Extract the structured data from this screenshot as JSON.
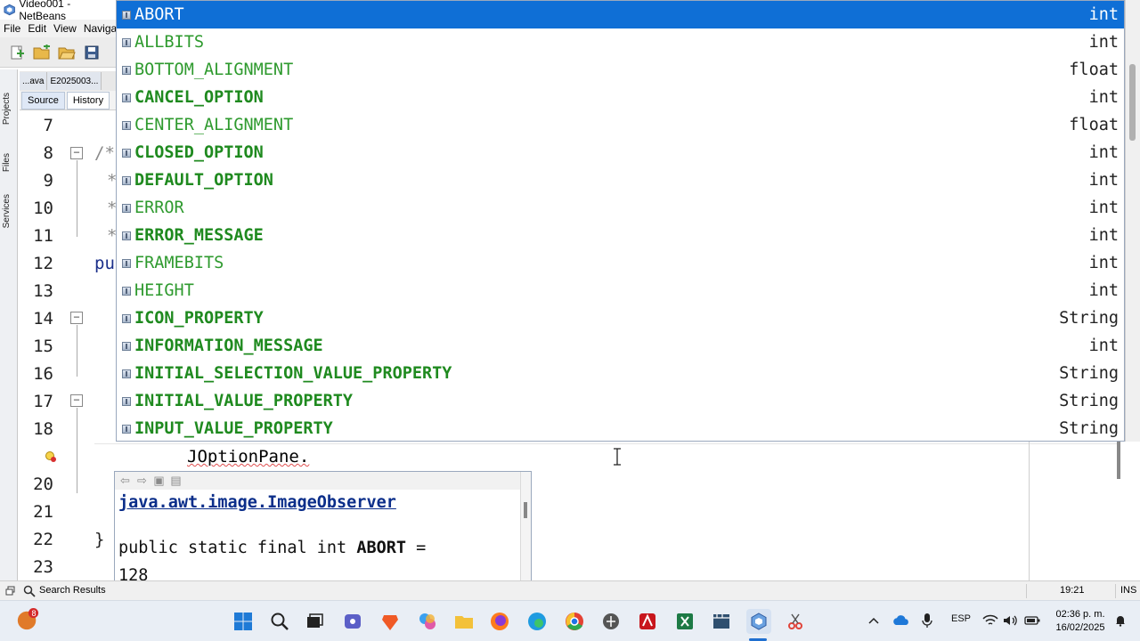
{
  "window": {
    "title": "Video001 - NetBeans"
  },
  "menu": [
    "File",
    "Edit",
    "View",
    "Navigate"
  ],
  "side_panels": [
    "Projects",
    "Files",
    "Services"
  ],
  "editor_tabs": [
    "...ava",
    "E2025003..."
  ],
  "editor_modes": {
    "source": "Source",
    "history": "History"
  },
  "code": {
    "line_numbers": [
      "7",
      "8",
      "9",
      "10",
      "11",
      "12",
      "13",
      "14",
      "15",
      "16",
      "17",
      "18",
      "20",
      "21",
      "22",
      "23"
    ],
    "fragments": {
      "comment_open": "/*",
      "star_9": "*",
      "star_10": "*",
      "star_11": "*",
      "pu": "pu",
      "close_brace": "}"
    },
    "typed": "JOptionPane",
    "typed_dot": "."
  },
  "completion": {
    "items": [
      {
        "name": "ABORT",
        "type": "int",
        "bold": false,
        "selected": true
      },
      {
        "name": "ALLBITS",
        "type": "int",
        "bold": false,
        "selected": false
      },
      {
        "name": "BOTTOM_ALIGNMENT",
        "type": "float",
        "bold": false,
        "selected": false
      },
      {
        "name": "CANCEL_OPTION",
        "type": "int",
        "bold": true,
        "selected": false
      },
      {
        "name": "CENTER_ALIGNMENT",
        "type": "float",
        "bold": false,
        "selected": false
      },
      {
        "name": "CLOSED_OPTION",
        "type": "int",
        "bold": true,
        "selected": false
      },
      {
        "name": "DEFAULT_OPTION",
        "type": "int",
        "bold": true,
        "selected": false
      },
      {
        "name": "ERROR",
        "type": "int",
        "bold": false,
        "selected": false
      },
      {
        "name": "ERROR_MESSAGE",
        "type": "int",
        "bold": true,
        "selected": false
      },
      {
        "name": "FRAMEBITS",
        "type": "int",
        "bold": false,
        "selected": false
      },
      {
        "name": "HEIGHT",
        "type": "int",
        "bold": false,
        "selected": false
      },
      {
        "name": "ICON_PROPERTY",
        "type": "String",
        "bold": true,
        "selected": false
      },
      {
        "name": "INFORMATION_MESSAGE",
        "type": "int",
        "bold": true,
        "selected": false
      },
      {
        "name": "INITIAL_SELECTION_VALUE_PROPERTY",
        "type": "String",
        "bold": true,
        "selected": false
      },
      {
        "name": "INITIAL_VALUE_PROPERTY",
        "type": "String",
        "bold": true,
        "selected": false
      },
      {
        "name": "INPUT_VALUE_PROPERTY",
        "type": "String",
        "bold": true,
        "selected": false
      }
    ],
    "selected_color": "#0f6fd6"
  },
  "javadoc": {
    "link": "java.awt.image.ImageObserver",
    "sig_prefix": "public static final int ",
    "sig_name": "ABORT",
    "sig_suffix": " =",
    "value": "128"
  },
  "status": {
    "search_results": "Search Results",
    "position": "19:21",
    "mode": "INS"
  },
  "taskbar": {
    "notification_count": "8",
    "language": "ESP",
    "time": "02:36 p. m.",
    "date": "16/02/2025"
  }
}
